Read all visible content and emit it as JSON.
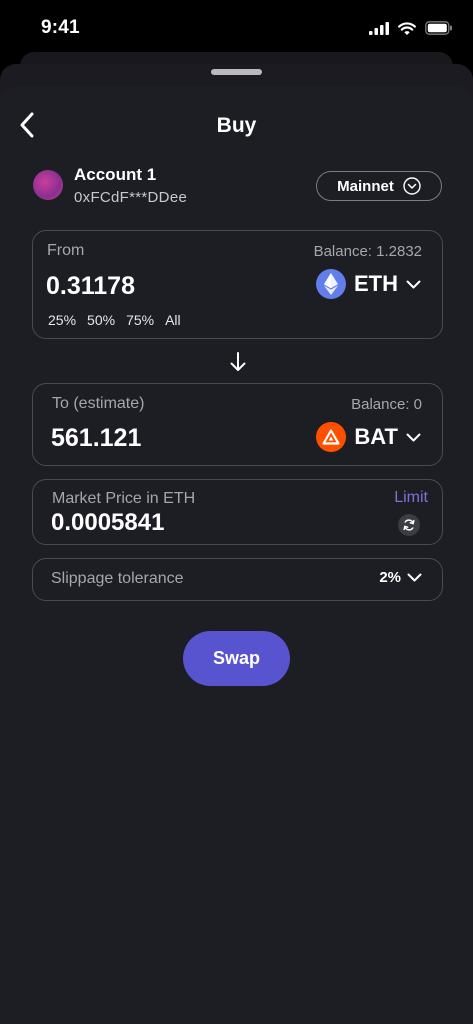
{
  "status": {
    "time": "9:41"
  },
  "header": {
    "title": "Buy"
  },
  "account": {
    "name": "Account 1",
    "address": "0xFCdF***DDee",
    "network": "Mainnet"
  },
  "from": {
    "label": "From",
    "balance": "Balance: 1.2832",
    "amount": "0.31178",
    "token": "ETH",
    "percents": [
      "25%",
      "50%",
      "75%",
      "All"
    ]
  },
  "to": {
    "label": "To (estimate)",
    "balance": "Balance: 0",
    "amount": "561.121",
    "token": "BAT"
  },
  "market": {
    "label": "Market Price in ETH",
    "value": "0.0005841",
    "limit_label": "Limit"
  },
  "slippage": {
    "label": "Slippage tolerance",
    "value": "2%"
  },
  "swap": {
    "label": "Swap"
  },
  "colors": {
    "accent": "#5854d0",
    "link": "#7b72d8",
    "eth": "#627eea",
    "bat": "#ff5000"
  },
  "icons": [
    "signal-icon",
    "wifi-icon",
    "battery-icon",
    "back-chevron-icon",
    "chevron-down-circle-icon",
    "ethereum-icon",
    "bat-icon",
    "chevron-down-icon",
    "arrow-down-icon",
    "refresh-icon"
  ]
}
